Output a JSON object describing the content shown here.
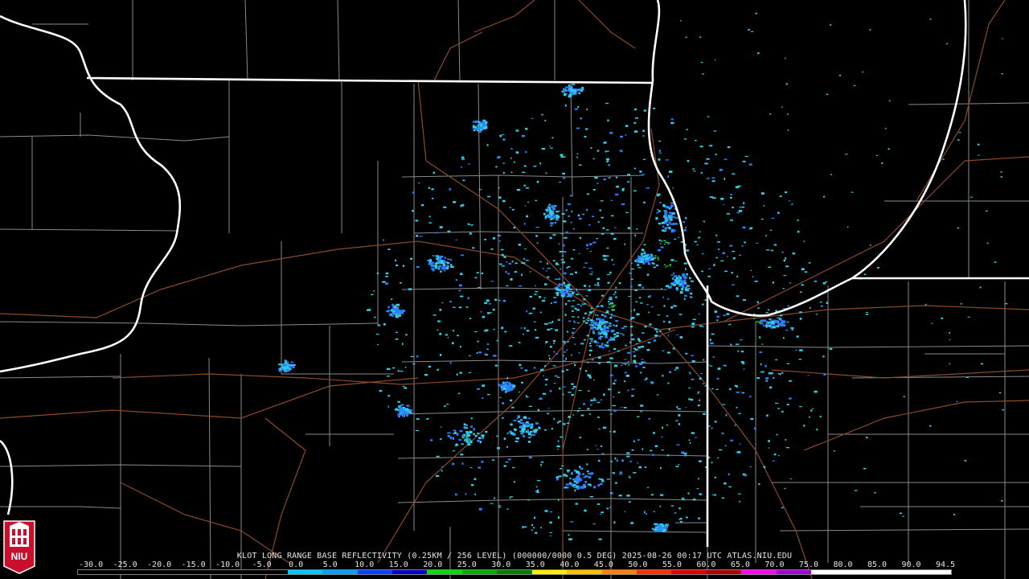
{
  "caption": "KLOT LONG RANGE BASE REFLECTIVITY (0.25KM / 256 LEVEL) (000000/0000 0.5 DEG) 2025-08-26 00:17 UTC  ATLAS.NIU.EDU",
  "logo": {
    "icon": "niu-huskie-shield-icon",
    "text": "NIU"
  },
  "legend": {
    "ticks": [
      "-30.0",
      "-25.0",
      "-20.0",
      "-15.0",
      "-10.0",
      "-5.0",
      "0.0",
      "5.0",
      "10.0",
      "15.0",
      "20.0",
      "25.0",
      "30.0",
      "35.0",
      "40.0",
      "45.0",
      "50.0",
      "55.0",
      "60.0",
      "65.0",
      "70.0",
      "75.0",
      "80.0",
      "85.0",
      "90.0",
      "94.5"
    ],
    "colors": [
      "#000000",
      "#000000",
      "#000000",
      "#000000",
      "#000000",
      "#000000",
      "#00c8ff",
      "#00a0ff",
      "#0040ff",
      "#0000c8",
      "#00e000",
      "#00b000",
      "#008000",
      "#fff000",
      "#ffc000",
      "#ff8000",
      "#ff3000",
      "#e00000",
      "#b00000",
      "#ff00ff",
      "#a000e0",
      "#ffffff",
      "#ffffff",
      "#ffffff",
      "#ffffff"
    ]
  },
  "colors": {
    "state_border": "#ffffff",
    "county_border": "#8a8a8a",
    "highway": "#8b4a2b",
    "echo_light": "#32d0e8",
    "echo_mid": "#2a80ff",
    "echo_strong": "#1cc41c"
  }
}
